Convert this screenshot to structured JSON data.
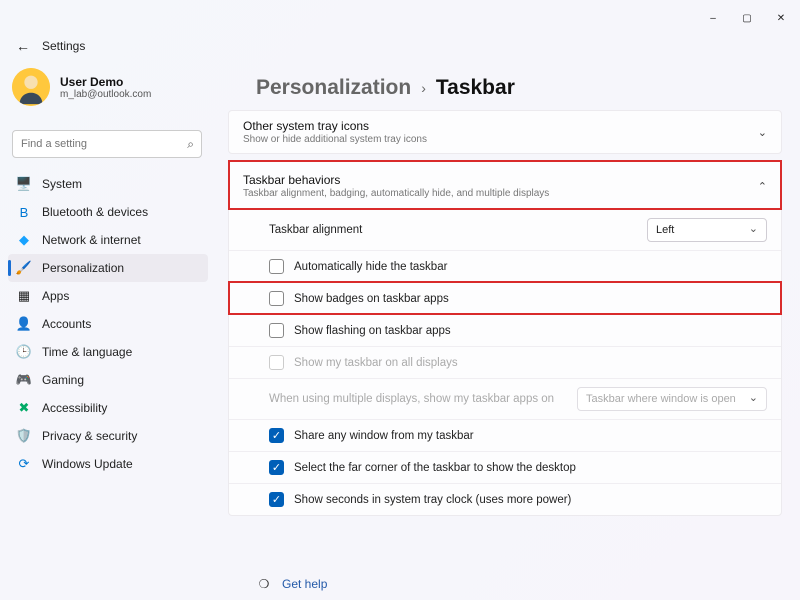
{
  "window": {
    "app": "Settings"
  },
  "user": {
    "name": "User Demo",
    "email": "m_lab@outlook.com"
  },
  "search": {
    "placeholder": "Find a setting"
  },
  "sidebar": [
    {
      "icon": "🖥️",
      "label": "System"
    },
    {
      "icon": "B",
      "label": "Bluetooth & devices",
      "color": "#0078d4"
    },
    {
      "icon": "◆",
      "label": "Network & internet",
      "color": "#17a2ff"
    },
    {
      "icon": "🖌️",
      "label": "Personalization",
      "active": true
    },
    {
      "icon": "▦",
      "label": "Apps"
    },
    {
      "icon": "👤",
      "label": "Accounts",
      "color": "#1f9c66"
    },
    {
      "icon": "🕒",
      "label": "Time & language"
    },
    {
      "icon": "🎮",
      "label": "Gaming"
    },
    {
      "icon": "✖",
      "label": "Accessibility",
      "color": "#0a6"
    },
    {
      "icon": "🛡️",
      "label": "Privacy & security"
    },
    {
      "icon": "⟳",
      "label": "Windows Update",
      "color": "#0078d4"
    }
  ],
  "breadcrumb": {
    "parent": "Personalization",
    "current": "Taskbar"
  },
  "cards": {
    "tray": {
      "title": "Other system tray icons",
      "sub": "Show or hide additional system tray icons"
    },
    "behaviors": {
      "title": "Taskbar behaviors",
      "sub": "Taskbar alignment, badging, automatically hide, and multiple displays"
    }
  },
  "rows": {
    "alignment": {
      "label": "Taskbar alignment",
      "value": "Left"
    },
    "autohide": {
      "label": "Automatically hide the taskbar",
      "checked": false
    },
    "badges": {
      "label": "Show badges on taskbar apps",
      "checked": false
    },
    "flashing": {
      "label": "Show flashing on taskbar apps",
      "checked": false
    },
    "multidisplay": {
      "label": "Show my taskbar on all displays",
      "checked": false,
      "disabled": true
    },
    "multidisp_where": {
      "label": "When using multiple displays, show my taskbar apps on",
      "value": "Taskbar where window is open",
      "disabled": true
    },
    "share": {
      "label": "Share any window from my taskbar",
      "checked": true
    },
    "far_corner": {
      "label": "Select the far corner of the taskbar to show the desktop",
      "checked": true
    },
    "seconds": {
      "label": "Show seconds in system tray clock (uses more power)",
      "checked": true
    }
  },
  "help": {
    "label": "Get help"
  }
}
